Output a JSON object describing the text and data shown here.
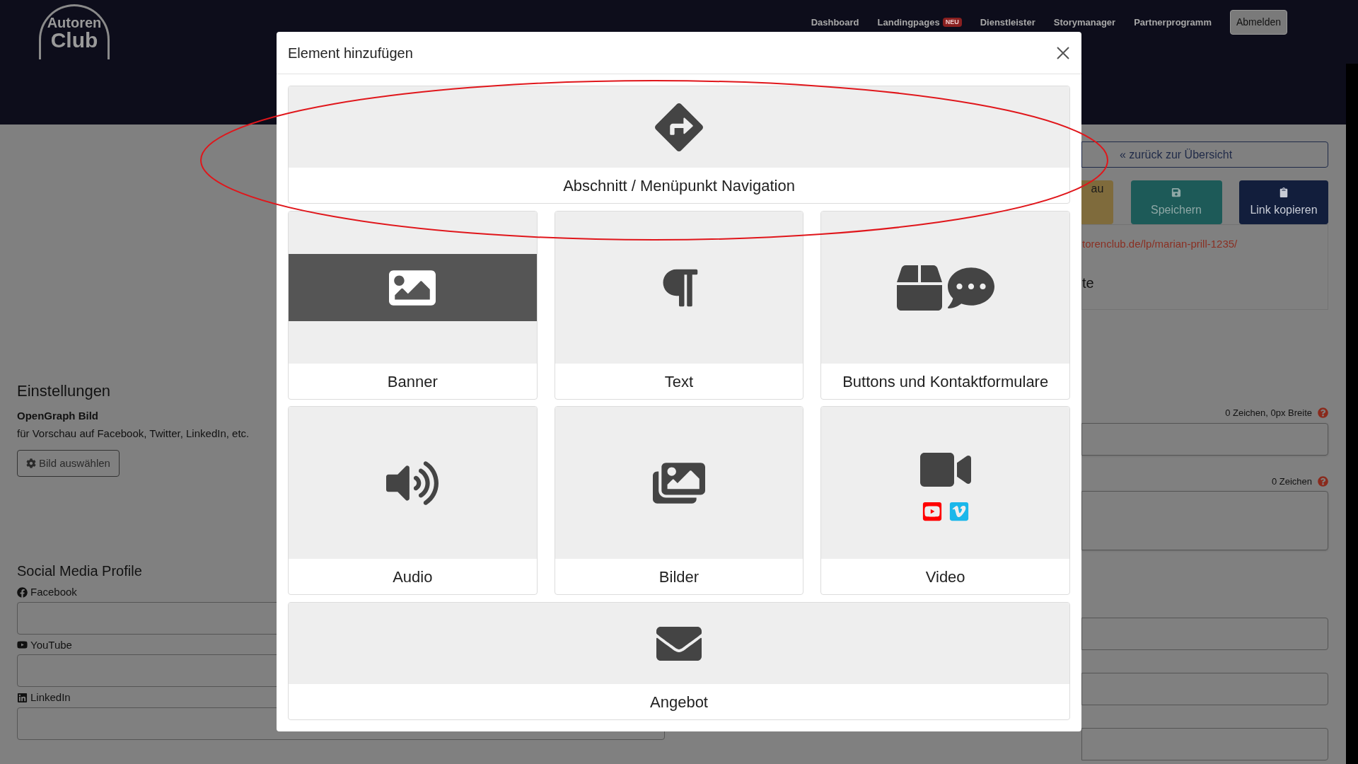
{
  "header": {
    "logo": {
      "line_1": "Autoren",
      "line_2": "Club"
    },
    "nav": [
      {
        "label": "Dashboard"
      },
      {
        "label": "Landingpages",
        "badge": "NEU"
      },
      {
        "label": "Dienstleister"
      },
      {
        "label": "Storymanager"
      },
      {
        "label": "Partnerprogramm"
      }
    ],
    "logout_button": "Abmelden"
  },
  "settings": {
    "title": "Einstellungen",
    "og_label": "OpenGraph Bild",
    "og_hint": "für Vorschau auf Facebook, Twitter, LinkedIn, etc.",
    "choose_button": "Bild auswählen"
  },
  "social": {
    "title": "Social Media Profile",
    "fields": [
      {
        "label": "Facebook",
        "kind": "facebook"
      },
      {
        "label": "YouTube",
        "kind": "youtube"
      },
      {
        "label": "LinkedIn",
        "kind": "linkedin"
      }
    ]
  },
  "right_panel": {
    "back_button": "« zurück zur Übersicht",
    "buttons": [
      {
        "label": "au",
        "kind": "partial"
      },
      {
        "label": "Speichern",
        "kind": "save"
      },
      {
        "label": "Link kopieren",
        "kind": "copy"
      }
    ],
    "url": "torenclub.de/lp/marian-prill-1235/",
    "text": "te",
    "title_counter": "0 Zeichen, 0px Breite",
    "description_counter": "0 Zeichen"
  },
  "modal": {
    "title": "Element hinzufügen",
    "items": [
      {
        "label": "Abschnitt / Menüpunkt Navigation",
        "kind": "navigation"
      },
      {
        "label": "Banner",
        "kind": "banner"
      },
      {
        "label": "Text",
        "kind": "text"
      },
      {
        "label": "Buttons und Kontaktformulare",
        "kind": "buttons"
      },
      {
        "label": "Audio",
        "kind": "audio"
      },
      {
        "label": "Bilder",
        "kind": "images"
      },
      {
        "label": "Video",
        "kind": "video"
      },
      {
        "label": "Angebot",
        "kind": "offer"
      }
    ]
  }
}
